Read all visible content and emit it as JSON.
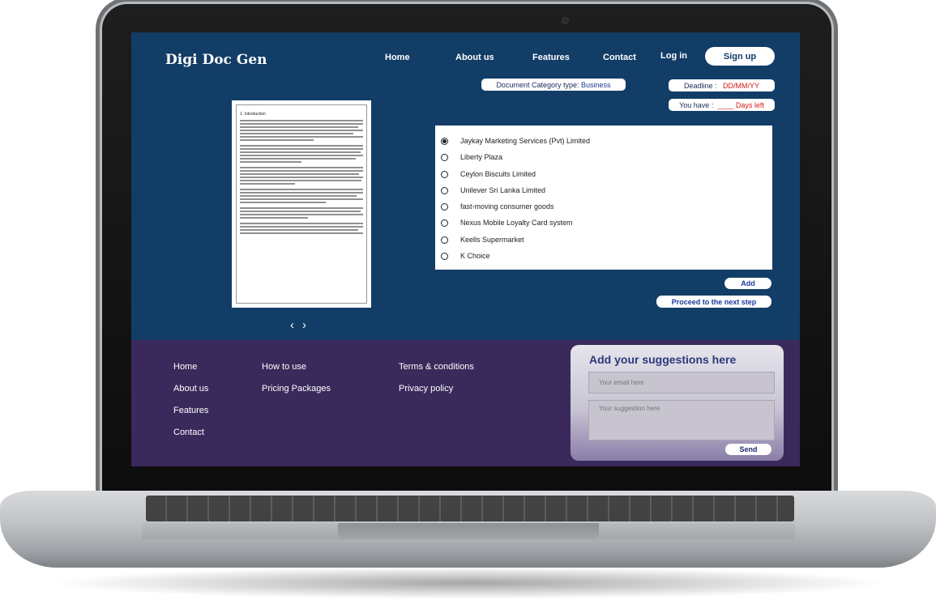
{
  "app": {
    "logo": "Digi Doc Gen"
  },
  "nav": {
    "home": "Home",
    "about": "About us",
    "features": "Features",
    "contact": "Contact",
    "login": "Log in",
    "signup": "Sign up"
  },
  "info": {
    "category_label": "Document Category type:",
    "category_value": "Business",
    "deadline_label": "Deadline :",
    "deadline_value": "DD/MM/YY",
    "you_have_label": "You have :",
    "you_have_value": "____ Days left"
  },
  "preview": {
    "heading": "1. Introduction",
    "prev_icon": "chevron-left-icon",
    "next_icon": "chevron-right-icon"
  },
  "options": [
    {
      "label": "Jaykay Marketing Services (Pvt) Limited",
      "selected": true
    },
    {
      "label": "Liberty Plaza",
      "selected": false
    },
    {
      "label": "Ceylon Biscuits Limited",
      "selected": false
    },
    {
      "label": "Unilever Sri Lanka Limited",
      "selected": false
    },
    {
      "label": "fast-moving consumer goods",
      "selected": false
    },
    {
      "label": "Nexus Mobile Loyalty Card system",
      "selected": false
    },
    {
      "label": "Keells Supermarket",
      "selected": false
    },
    {
      "label": "K Choice",
      "selected": false
    }
  ],
  "actions": {
    "add": "Add",
    "proceed": "Proceed to the next step"
  },
  "footer": {
    "col1": [
      "Home",
      "About us",
      "Features",
      "Contact"
    ],
    "col2": [
      "How to use",
      "Pricing Packages"
    ],
    "col3": [
      "Terms & conditions",
      "Privacy policy"
    ]
  },
  "suggestions": {
    "title": "Add your suggestions here",
    "email_placeholder": "Your email here",
    "suggestion_placeholder": "Your suggestion here",
    "send": "Send"
  },
  "colors": {
    "main_bg": "#123d66",
    "footer_bg": "#3a2a5c",
    "accent_red": "#d21a1a"
  }
}
